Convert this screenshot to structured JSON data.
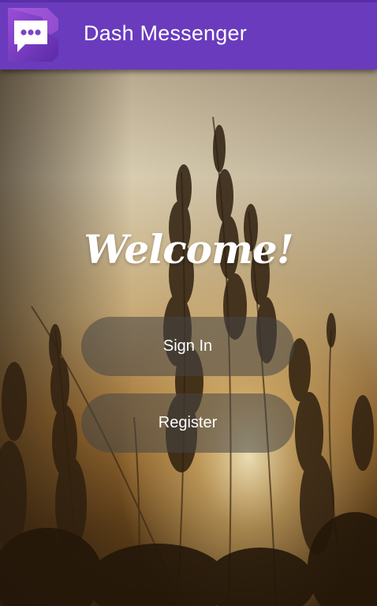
{
  "app_bar": {
    "title": "Dash Messenger",
    "logo_icon": "chat-bubble-icon",
    "background_color": "#6a3bbd"
  },
  "welcome": {
    "text": "Welcome!"
  },
  "actions": {
    "sign_in_label": "Sign In",
    "register_label": "Register"
  }
}
